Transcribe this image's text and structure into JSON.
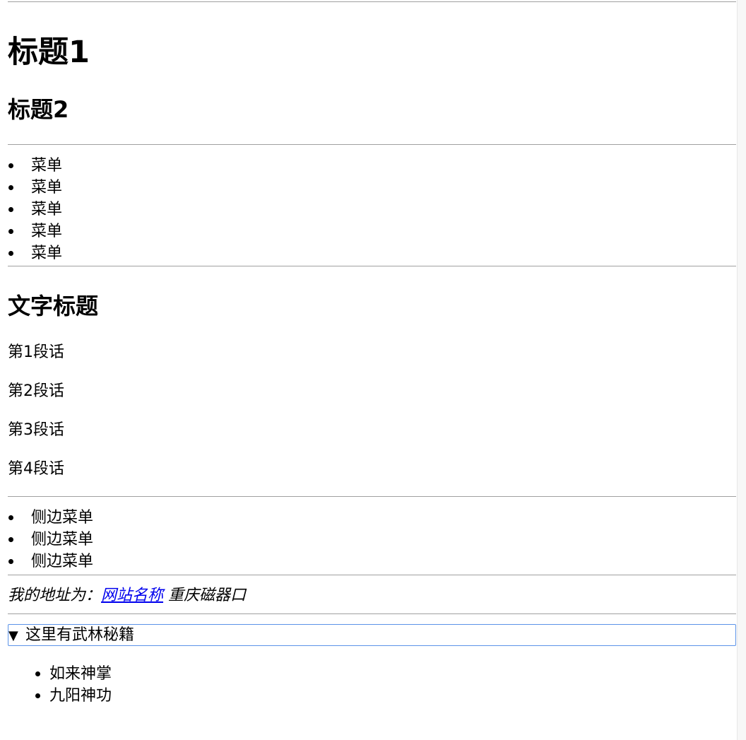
{
  "heading1": "标题1",
  "heading2": "标题2",
  "nav": {
    "items": [
      "菜单",
      "菜单",
      "菜单",
      "菜单",
      "菜单"
    ]
  },
  "article": {
    "title": "文字标题",
    "paragraphs": [
      "第1段话",
      "第2段话",
      "第3段话",
      "第4段话"
    ]
  },
  "aside": {
    "items": [
      "侧边菜单",
      "侧边菜单",
      "侧边菜单"
    ]
  },
  "address": {
    "prefix": "我的地址为：",
    "link_text": "网站名称",
    "suffix": "重庆磁器口"
  },
  "details": {
    "summary_icon": "triangle-down-icon",
    "summary_glyph": "▼",
    "summary": "这里有武林秘籍",
    "items": [
      "如来神掌",
      "九阳神功"
    ]
  },
  "colors": {
    "link": "#0000ee",
    "focus_outline": "#5b93e8",
    "rule": "#a0a0a0"
  }
}
